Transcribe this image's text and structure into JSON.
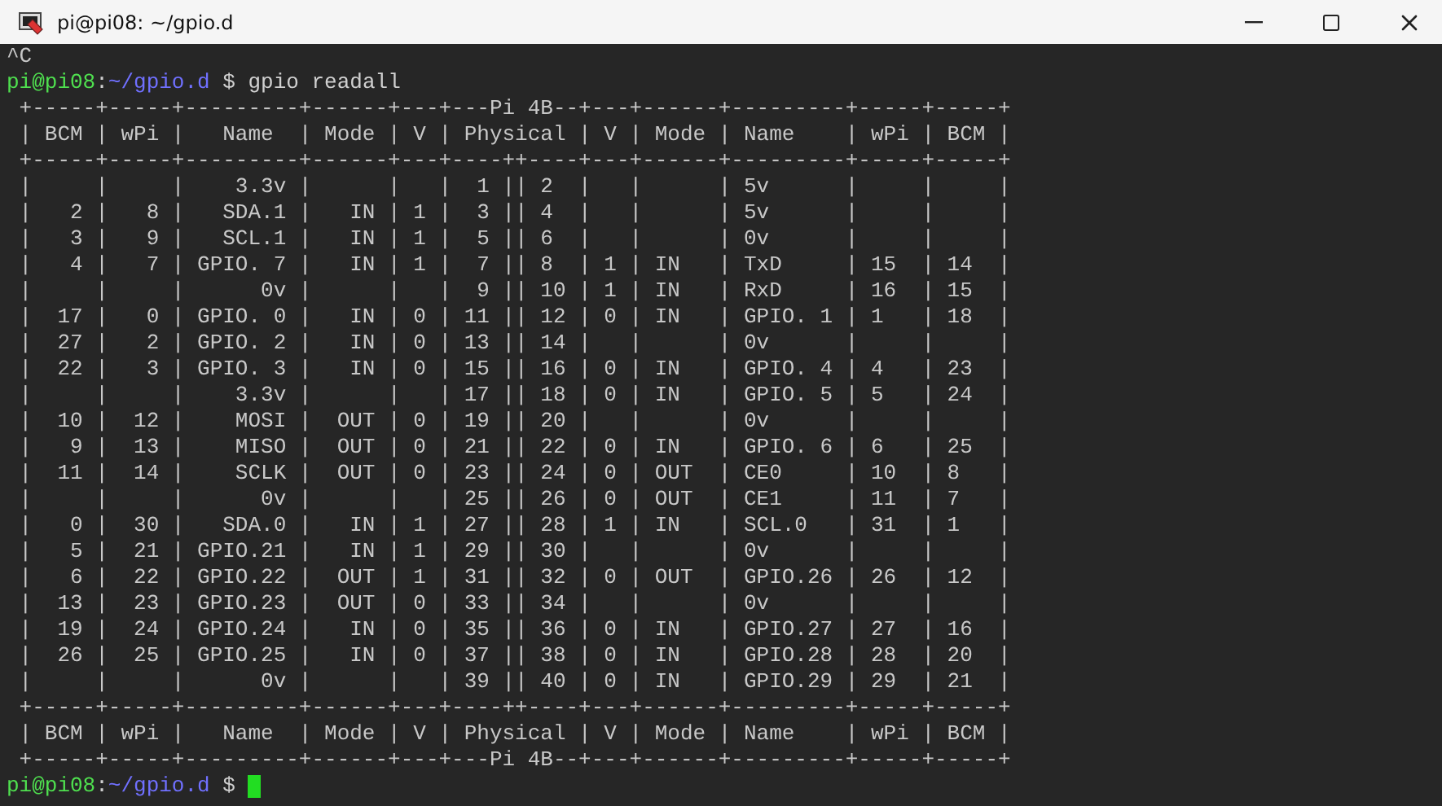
{
  "window": {
    "title": "pi@pi08: ~/gpio.d"
  },
  "lines": [
    {
      "kind": "text",
      "text": "^C"
    },
    {
      "kind": "prompt",
      "user": "pi@pi08",
      "separator": ":",
      "path": "~/gpio.d",
      "symbol": "$",
      "command": "gpio readall",
      "cursor": false
    },
    {
      "kind": "text",
      "text": " +-----+-----+---------+------+---+---Pi 4B--+---+------+---------+-----+-----+"
    },
    {
      "kind": "text",
      "text": " | BCM | wPi |   Name  | Mode | V | Physical | V | Mode | Name    | wPi | BCM |"
    },
    {
      "kind": "text",
      "text": " +-----+-----+---------+------+---+----++----+---+------+---------+-----+-----+"
    },
    {
      "kind": "text",
      "text": " |     |     |    3.3v |      |   |  1 || 2  |   |      | 5v      |     |     |"
    },
    {
      "kind": "text",
      "text": " |   2 |   8 |   SDA.1 |   IN | 1 |  3 || 4  |   |      | 5v      |     |     |"
    },
    {
      "kind": "text",
      "text": " |   3 |   9 |   SCL.1 |   IN | 1 |  5 || 6  |   |      | 0v      |     |     |"
    },
    {
      "kind": "text",
      "text": " |   4 |   7 | GPIO. 7 |   IN | 1 |  7 || 8  | 1 | IN   | TxD     | 15  | 14  |"
    },
    {
      "kind": "text",
      "text": " |     |     |      0v |      |   |  9 || 10 | 1 | IN   | RxD     | 16  | 15  |"
    },
    {
      "kind": "text",
      "text": " |  17 |   0 | GPIO. 0 |   IN | 0 | 11 || 12 | 0 | IN   | GPIO. 1 | 1   | 18  |"
    },
    {
      "kind": "text",
      "text": " |  27 |   2 | GPIO. 2 |   IN | 0 | 13 || 14 |   |      | 0v      |     |     |"
    },
    {
      "kind": "text",
      "text": " |  22 |   3 | GPIO. 3 |   IN | 0 | 15 || 16 | 0 | IN   | GPIO. 4 | 4   | 23  |"
    },
    {
      "kind": "text",
      "text": " |     |     |    3.3v |      |   | 17 || 18 | 0 | IN   | GPIO. 5 | 5   | 24  |"
    },
    {
      "kind": "text",
      "text": " |  10 |  12 |    MOSI |  OUT | 0 | 19 || 20 |   |      | 0v      |     |     |"
    },
    {
      "kind": "text",
      "text": " |   9 |  13 |    MISO |  OUT | 0 | 21 || 22 | 0 | IN   | GPIO. 6 | 6   | 25  |"
    },
    {
      "kind": "text",
      "text": " |  11 |  14 |    SCLK |  OUT | 0 | 23 || 24 | 0 | OUT  | CE0     | 10  | 8   |"
    },
    {
      "kind": "text",
      "text": " |     |     |      0v |      |   | 25 || 26 | 0 | OUT  | CE1     | 11  | 7   |"
    },
    {
      "kind": "text",
      "text": " |   0 |  30 |   SDA.0 |   IN | 1 | 27 || 28 | 1 | IN   | SCL.0   | 31  | 1   |"
    },
    {
      "kind": "text",
      "text": " |   5 |  21 | GPIO.21 |   IN | 1 | 29 || 30 |   |      | 0v      |     |     |"
    },
    {
      "kind": "text",
      "text": " |   6 |  22 | GPIO.22 |  OUT | 1 | 31 || 32 | 0 | OUT  | GPIO.26 | 26  | 12  |"
    },
    {
      "kind": "text",
      "text": " |  13 |  23 | GPIO.23 |  OUT | 0 | 33 || 34 |   |      | 0v      |     |     |"
    },
    {
      "kind": "text",
      "text": " |  19 |  24 | GPIO.24 |   IN | 0 | 35 || 36 | 0 | IN   | GPIO.27 | 27  | 16  |"
    },
    {
      "kind": "text",
      "text": " |  26 |  25 | GPIO.25 |   IN | 0 | 37 || 38 | 0 | IN   | GPIO.28 | 28  | 20  |"
    },
    {
      "kind": "text",
      "text": " |     |     |      0v |      |   | 39 || 40 | 0 | IN   | GPIO.29 | 29  | 21  |"
    },
    {
      "kind": "text",
      "text": " +-----+-----+---------+------+---+----++----+---+------+---------+-----+-----+"
    },
    {
      "kind": "text",
      "text": " | BCM | wPi |   Name  | Mode | V | Physical | V | Mode | Name    | wPi | BCM |"
    },
    {
      "kind": "text",
      "text": " +-----+-----+---------+------+---+---Pi 4B--+---+------+---------+-----+-----+"
    },
    {
      "kind": "prompt",
      "user": "pi@pi08",
      "separator": ":",
      "path": "~/gpio.d",
      "symbol": "$",
      "cursor": true
    }
  ]
}
